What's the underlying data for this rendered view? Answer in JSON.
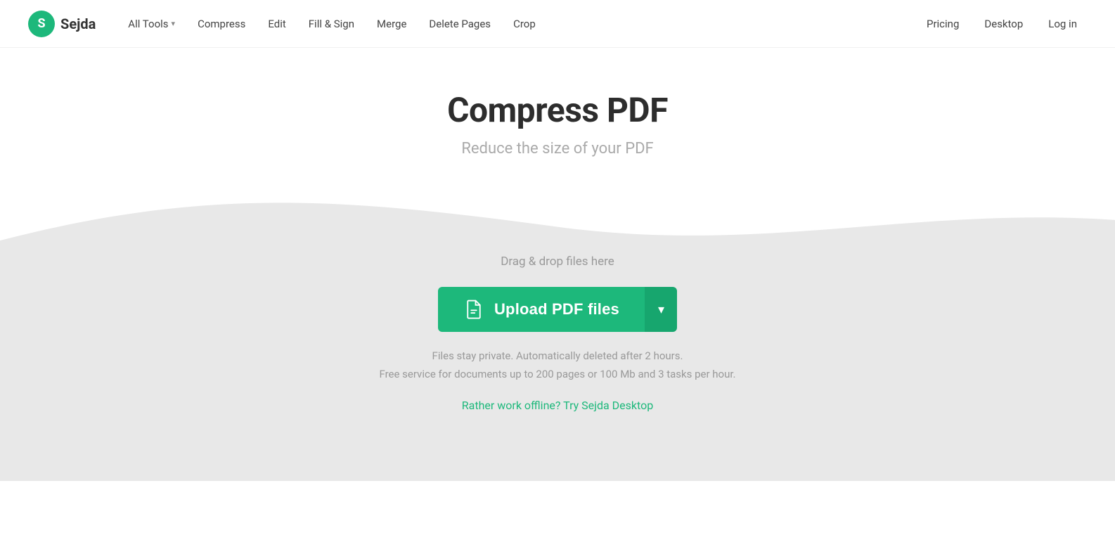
{
  "header": {
    "logo_letter": "S",
    "logo_name": "Sejda",
    "nav_items": [
      {
        "label": "All Tools",
        "has_chevron": true
      },
      {
        "label": "Compress",
        "has_chevron": false
      },
      {
        "label": "Edit",
        "has_chevron": false
      },
      {
        "label": "Fill & Sign",
        "has_chevron": false
      },
      {
        "label": "Merge",
        "has_chevron": false
      },
      {
        "label": "Delete Pages",
        "has_chevron": false
      },
      {
        "label": "Crop",
        "has_chevron": false
      }
    ],
    "nav_right": [
      {
        "label": "Pricing"
      },
      {
        "label": "Desktop"
      },
      {
        "label": "Log in"
      }
    ]
  },
  "hero": {
    "title": "Compress PDF",
    "subtitle": "Reduce the size of your PDF"
  },
  "upload": {
    "drag_drop_text": "Drag & drop files here",
    "button_label": "Upload PDF files",
    "button_arrow": "▾",
    "privacy_line1": "Files stay private. Automatically deleted after 2 hours.",
    "privacy_line2": "Free service for documents up to 200 pages or 100 Mb and 3 tasks per hour.",
    "offline_text": "Rather work offline? Try Sejda Desktop"
  },
  "colors": {
    "brand_green": "#1db87b",
    "text_dark": "#2d2d2d",
    "text_gray": "#999999",
    "wave_bg": "#ebebeb"
  }
}
